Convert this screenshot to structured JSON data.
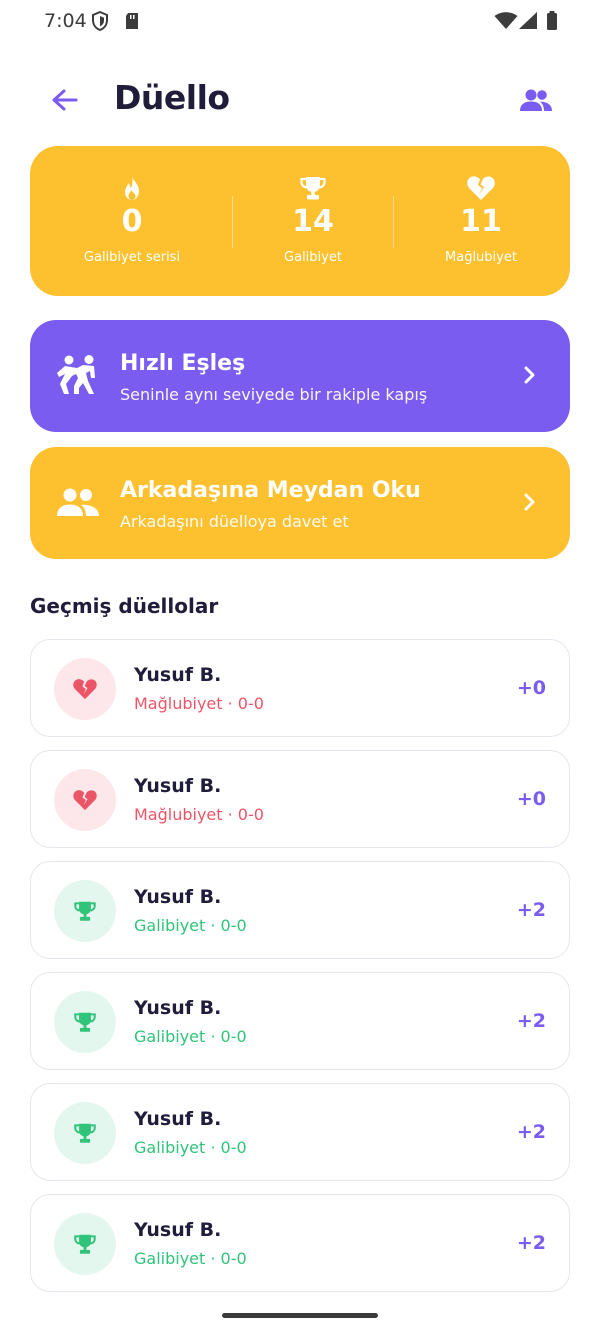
{
  "status_bar": {
    "time": "7:04"
  },
  "header": {
    "title": "Düello"
  },
  "stats": [
    {
      "value": "0",
      "label": "Galibiyet serisi",
      "icon": "flame-icon"
    },
    {
      "value": "14",
      "label": "Galibiyet",
      "icon": "trophy-icon"
    },
    {
      "value": "11",
      "label": "Mağlubiyet",
      "icon": "broken-heart-icon"
    }
  ],
  "quick_match": {
    "title": "Hızlı Eşleş",
    "subtitle": "Seninle aynı seviyede bir rakiple kapış"
  },
  "challenge_friend": {
    "title": "Arkadaşına Meydan Oku",
    "subtitle": "Arkadaşını düelloya davet et"
  },
  "history": {
    "title": "Geçmiş düellolar",
    "items": [
      {
        "name": "Yusuf B.",
        "result": "Mağlubiyet · 0-0",
        "points": "+0",
        "outcome": "loss"
      },
      {
        "name": "Yusuf B.",
        "result": "Mağlubiyet · 0-0",
        "points": "+0",
        "outcome": "loss"
      },
      {
        "name": "Yusuf B.",
        "result": "Galibiyet · 0-0",
        "points": "+2",
        "outcome": "win"
      },
      {
        "name": "Yusuf B.",
        "result": "Galibiyet · 0-0",
        "points": "+2",
        "outcome": "win"
      },
      {
        "name": "Yusuf B.",
        "result": "Galibiyet · 0-0",
        "points": "+2",
        "outcome": "win"
      },
      {
        "name": "Yusuf B.",
        "result": "Galibiyet · 0-0",
        "points": "+2",
        "outcome": "win"
      }
    ]
  },
  "colors": {
    "accent_purple": "#7a5cf0",
    "accent_yellow": "#fdc02f",
    "loss_red": "#ec5568",
    "win_green": "#2fc47a"
  }
}
